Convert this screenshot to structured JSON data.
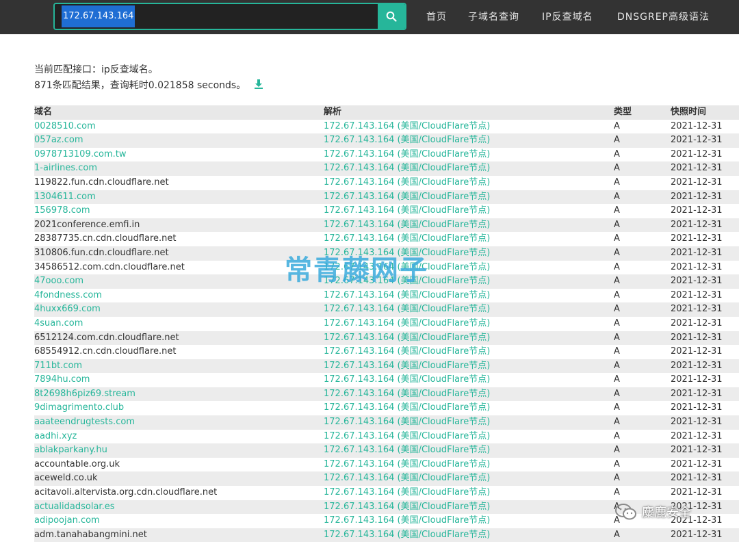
{
  "header": {
    "search_value": "172.67.143.164",
    "nav": [
      "首页",
      "子域名查询",
      "IP反查域名",
      "DNSGREP高级语法"
    ]
  },
  "info": {
    "line1": "当前匹配接口：ip反查域名。",
    "line2": "871条匹配结果，查询耗时0.021858 seconds。"
  },
  "table": {
    "headers": [
      "域名",
      "解析",
      "类型",
      "快照时间"
    ],
    "rows": [
      {
        "domain": "0028510.com",
        "linked": true
      },
      {
        "domain": "057az.com",
        "linked": true
      },
      {
        "domain": "0978713109.com.tw",
        "linked": true
      },
      {
        "domain": "1-airlines.com",
        "linked": true
      },
      {
        "domain": "119822.fun.cdn.cloudflare.net",
        "linked": false
      },
      {
        "domain": "1304611.com",
        "linked": true
      },
      {
        "domain": "156978.com",
        "linked": true
      },
      {
        "domain": "2021conference.emfi.in",
        "linked": false
      },
      {
        "domain": "28387735.cn.cdn.cloudflare.net",
        "linked": false
      },
      {
        "domain": "310806.fun.cdn.cloudflare.net",
        "linked": false
      },
      {
        "domain": "34586512.com.cdn.cloudflare.net",
        "linked": false
      },
      {
        "domain": "47ooo.com",
        "linked": true
      },
      {
        "domain": "4fondness.com",
        "linked": true
      },
      {
        "domain": "4huxx669.com",
        "linked": true
      },
      {
        "domain": "4suan.com",
        "linked": true
      },
      {
        "domain": "6512124.com.cdn.cloudflare.net",
        "linked": false
      },
      {
        "domain": "68554912.cn.cdn.cloudflare.net",
        "linked": false
      },
      {
        "domain": "711bt.com",
        "linked": true
      },
      {
        "domain": "7894hu.com",
        "linked": true
      },
      {
        "domain": "8t2698h6piz69.stream",
        "linked": true
      },
      {
        "domain": "9dimagrimento.club",
        "linked": true
      },
      {
        "domain": "aaateendrugtests.com",
        "linked": true
      },
      {
        "domain": "aadhi.xyz",
        "linked": true
      },
      {
        "domain": "ablakparkany.hu",
        "linked": true
      },
      {
        "domain": "accountable.org.uk",
        "linked": false
      },
      {
        "domain": "aceweld.co.uk",
        "linked": false
      },
      {
        "domain": "acitavoli.altervista.org.cdn.cloudflare.net",
        "linked": false
      },
      {
        "domain": "actualidadsolar.es",
        "linked": true
      },
      {
        "domain": "adipoojan.com",
        "linked": true
      },
      {
        "domain": "adm.tanahabangmini.net",
        "linked": false
      }
    ],
    "resolve_text": "172.67.143.164 (美国/CloudFlare节点)",
    "type_text": "A",
    "date_text": "2021-12-31"
  },
  "overlay": {
    "watermark": "常青藤网子",
    "badge": "麋鹿安全"
  },
  "icons": {
    "search": "search-icon",
    "download": "download-icon",
    "wechat": "wechat-icon"
  },
  "colors": {
    "accent": "#26b69a",
    "topbar": "#333333",
    "selection": "#1f6ed4"
  }
}
